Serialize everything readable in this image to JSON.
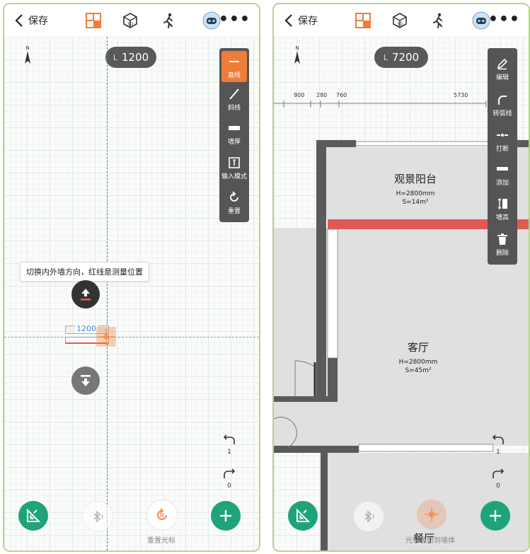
{
  "left": {
    "topbar": {
      "back_label": "保存"
    },
    "length": {
      "prefix": "L",
      "value": "1200"
    },
    "tools": [
      {
        "label": "直线",
        "icon": "straight-line-icon",
        "active": true
      },
      {
        "label": "斜线",
        "icon": "diagonal-line-icon"
      },
      {
        "label": "墙厚",
        "icon": "wall-thickness-icon"
      },
      {
        "label": "输入模式",
        "icon": "input-mode-icon"
      },
      {
        "label": "重置",
        "icon": "reset-icon"
      }
    ],
    "tooltip": "切换内外墙方向，红线是测量位置",
    "wall_dimension": "1200",
    "undo_count": "1",
    "redo_count": "0",
    "bottom": {
      "reset_cursor_label": "重置光标"
    }
  },
  "right": {
    "topbar": {
      "back_label": "保存"
    },
    "length": {
      "prefix": "L",
      "value": "7200"
    },
    "dimensions": [
      "900",
      "280",
      "760",
      "5730"
    ],
    "tools": [
      {
        "label": "编辑",
        "icon": "edit-icon"
      },
      {
        "label": "转弧线",
        "icon": "arc-icon"
      },
      {
        "label": "打断",
        "icon": "break-icon"
      },
      {
        "label": "添加",
        "icon": "add-wall-icon"
      },
      {
        "label": "墙高",
        "icon": "wall-height-icon"
      },
      {
        "label": "删除",
        "icon": "delete-icon"
      }
    ],
    "rooms": [
      {
        "name": "观景阳台",
        "height": "H=2800mm",
        "area": "S=14m²"
      },
      {
        "name": "客厅",
        "height": "H=2800mm",
        "area": "S=45m²"
      },
      {
        "name": "餐厅"
      }
    ],
    "undo_count": "1",
    "redo_count": "0",
    "bottom": {
      "snap_label": "光标吸附到墙体"
    }
  },
  "colors": {
    "accent": "#ef7d3a",
    "green": "#1ea37a",
    "panel": "#555555",
    "wall": "#5a5a5a",
    "selected_wall": "#e05a55"
  }
}
